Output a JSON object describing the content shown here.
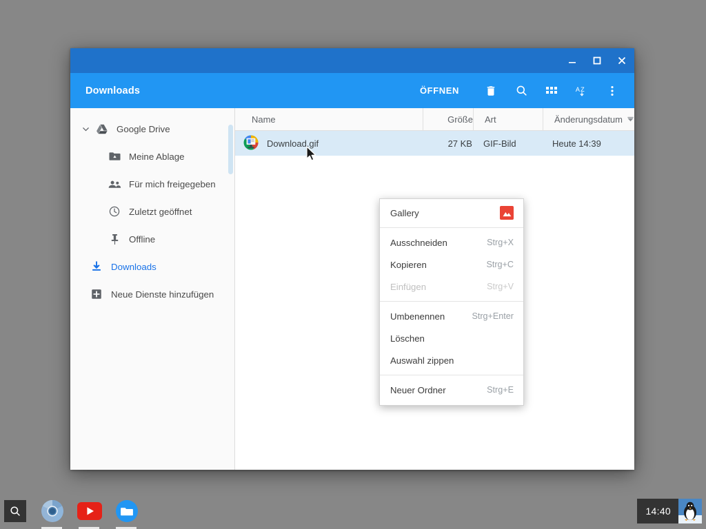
{
  "desktop": {
    "background_color": "#878787"
  },
  "window": {
    "titlebar": {
      "minimize_label": "Minimieren",
      "maximize_label": "Maximieren",
      "close_label": "Schließen",
      "color": "#1f72ca"
    },
    "toolbar": {
      "title": "Downloads",
      "color": "#2196f3",
      "open_label": "ÖFFNEN",
      "delete_icon": "trash-icon",
      "search_icon": "search-icon",
      "view_icon": "grid-view-icon",
      "sort_icon": "sort-az-icon",
      "more_icon": "more-vertical-icon"
    }
  },
  "sidebar": {
    "items": [
      {
        "label": "Google Drive",
        "icon": "google-drive-icon",
        "level": "root",
        "expanded": true,
        "active": false
      },
      {
        "label": "Meine Ablage",
        "icon": "my-drive-folder-icon",
        "level": "sub",
        "active": false
      },
      {
        "label": "Für mich freigegeben",
        "icon": "shared-people-icon",
        "level": "sub",
        "active": false
      },
      {
        "label": "Zuletzt geöffnet",
        "icon": "clock-icon",
        "level": "sub",
        "active": false
      },
      {
        "label": "Offline",
        "icon": "pin-icon",
        "level": "sub",
        "active": false
      },
      {
        "label": "Downloads",
        "icon": "download-icon",
        "level": "top",
        "active": true
      },
      {
        "label": "Neue Dienste hinzufügen",
        "icon": "add-service-icon",
        "level": "top",
        "active": false
      }
    ],
    "active_color": "#1a73e8"
  },
  "filelist": {
    "columns": {
      "name": "Name",
      "size": "Größe",
      "type": "Art",
      "date": "Änderungsdatum"
    },
    "sort_column": "Änderungsdatum",
    "sort_indicator": "sort-descending-icon",
    "rows": [
      {
        "icon": "gif-image-thumbnail-icon",
        "name": "Download.gif",
        "size": "27 KB",
        "type": "GIF-Bild",
        "date": "Heute 14:39",
        "selected": true
      }
    ],
    "selected_row_color": "#d9eaf7"
  },
  "context_menu": {
    "groups": [
      {
        "items": [
          {
            "label": "Gallery",
            "accel": "",
            "disabled": false,
            "trailing_icon": "gallery-app-icon"
          }
        ]
      },
      {
        "items": [
          {
            "label": "Ausschneiden",
            "accel": "Strg+X",
            "disabled": false
          },
          {
            "label": "Kopieren",
            "accel": "Strg+C",
            "disabled": false
          },
          {
            "label": "Einfügen",
            "accel": "Strg+V",
            "disabled": true
          }
        ]
      },
      {
        "items": [
          {
            "label": "Umbenennen",
            "accel": "Strg+Enter",
            "disabled": false
          },
          {
            "label": "Löschen",
            "accel": "",
            "disabled": false
          },
          {
            "label": "Auswahl zippen",
            "accel": "",
            "disabled": false
          }
        ]
      },
      {
        "items": [
          {
            "label": "Neuer Ordner",
            "accel": "Strg+E",
            "disabled": false
          }
        ]
      }
    ],
    "gallery_icon_color": "#ea4335"
  },
  "shelf": {
    "launcher_icon": "search-icon",
    "apps": [
      {
        "name": "Chromium",
        "icon": "chromium-icon",
        "running": true
      },
      {
        "name": "YouTube",
        "icon": "youtube-icon",
        "running": true
      },
      {
        "name": "Dateien",
        "icon": "files-app-icon",
        "running": true
      }
    ],
    "clock": "14:40",
    "avatar_icon": "penguin-avatar-icon"
  }
}
